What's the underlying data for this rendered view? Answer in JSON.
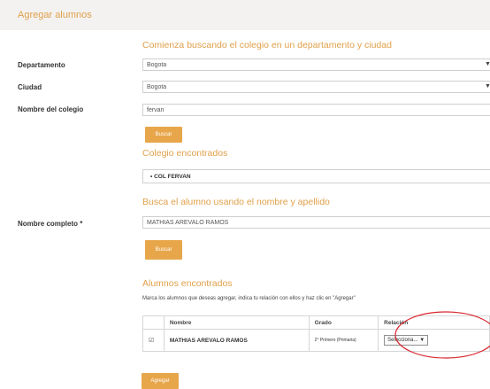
{
  "header": {
    "title": "Agregar alumnos"
  },
  "school_search": {
    "section_title": "Comienza buscando el colegio en un departamento y ciudad",
    "department_label": "Departamento",
    "department_value": "Bogota",
    "city_label": "Ciudad",
    "city_value": "Bogota",
    "school_label": "Nombre del colegio",
    "school_value": "fervan",
    "search_button": "Buscar"
  },
  "schools_found": {
    "title": "Colegio encontrados",
    "selected_school": "COL FERVAN"
  },
  "student_search": {
    "section_title": "Busca el alumno usando el nombre y apellido",
    "name_label": "Nombre completo *",
    "name_value": "MATHIAS AREVALO RAMOS",
    "search_button": "Buscar"
  },
  "students_found": {
    "title": "Alumnos encontrados",
    "help_text": "Marca los alumnos que deseas agregar, indica tu relación con ellos y haz clic en \"Agregar\"",
    "columns": [
      "",
      "Nombre",
      "Grado",
      "Relación"
    ],
    "rows": [
      {
        "checked_mark": "☑",
        "name": "MATHIAS AREVALO RAMOS",
        "grade": "2° Primero (Primaria)",
        "relation": "Selecciona..."
      }
    ]
  },
  "add_button": "Agregar",
  "colors": {
    "accent": "#e0a04a",
    "button": "#e8a64a",
    "annotation": "#d9262e"
  }
}
